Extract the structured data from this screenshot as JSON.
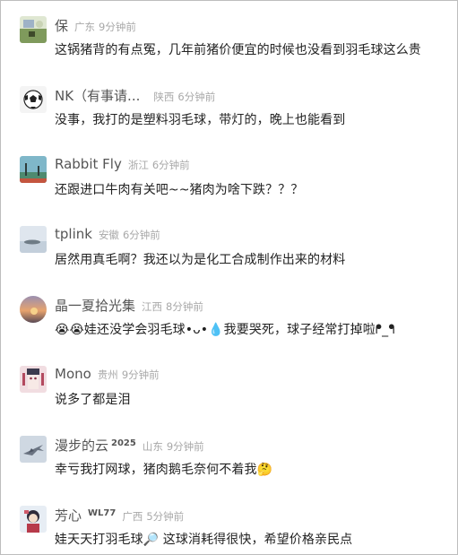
{
  "comments": [
    {
      "avatar": "landscape-avatar",
      "name": "保",
      "location": "广东",
      "time": "9分钟前",
      "text": "这锅猪背的有点冤，几年前猪价便宜的时候也没看到羽毛球这么贵"
    },
    {
      "avatar": "soccer-ball-avatar",
      "name": "NK（有事请...",
      "location": "陕西",
      "time": "6分钟前",
      "text": "没事，我打的是塑料羽毛球，带灯的，晚上也能看到"
    },
    {
      "avatar": "tree-sky-avatar",
      "name": "Rabbit Fly",
      "location": "浙江",
      "time": "6分钟前",
      "text": "还跟进口牛肉有关吧~~猪肉为啥下跌？？？"
    },
    {
      "avatar": "island-avatar",
      "name": "tplink",
      "location": "安徽",
      "time": "6分钟前",
      "text": "居然用真毛啊？我还以为是化工合成制作出来的材料"
    },
    {
      "avatar": "sunset-avatar",
      "name": "晶一夏拾光集",
      "location": "江西",
      "time": "8分钟前",
      "text": "😭😭娃还没学会羽毛球•ᴗ•💧我要哭死，球子经常打掉啦ᖰ_ᖳ"
    },
    {
      "avatar": "anime-avatar",
      "name": "Mono",
      "location": "贵州",
      "time": "9分钟前",
      "text": "说多了都是泪"
    },
    {
      "avatar": "jet-avatar",
      "name": "漫步的云",
      "badge": "2025",
      "location": "山东",
      "time": "9分钟前",
      "text": "幸亏我打网球，猪肉鹅毛奈何不着我🤔"
    },
    {
      "avatar": "cartoon-avatar",
      "name": "芳心",
      "badge": "WL77",
      "location": "广西",
      "time": "5分钟前",
      "text": "娃天天打羽毛球🔎 这球消耗得很快，希望价格亲民点"
    }
  ]
}
